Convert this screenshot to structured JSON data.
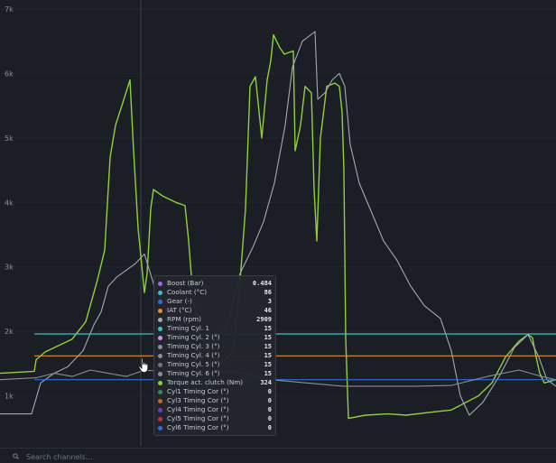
{
  "y_axis": {
    "ticks": [
      "7k",
      "6k",
      "5k",
      "4k",
      "3k",
      "2k",
      "1k"
    ]
  },
  "tooltip": {
    "rows": [
      {
        "name": "Boost (Bar)",
        "value": "0.484",
        "color": "#9b6bdc"
      },
      {
        "name": "Coolant (°C)",
        "value": "86",
        "color": "#3ec0c8"
      },
      {
        "name": "Gear (-)",
        "value": "3",
        "color": "#2f6fd6"
      },
      {
        "name": "IAT (°C)",
        "value": "46",
        "color": "#e0902a"
      },
      {
        "name": "RPM (rpm)",
        "value": "2909",
        "color": "#a4a8b0"
      },
      {
        "name": "Timing Cyl. 1",
        "value": "15",
        "color": "#3ec0c8"
      },
      {
        "name": "Timing Cyl. 2 (°)",
        "value": "15",
        "color": "#b99be6"
      },
      {
        "name": "Timing Cyl. 3 (°)",
        "value": "15",
        "color": "#8a8f99"
      },
      {
        "name": "Timing Cyl. 4 (°)",
        "value": "15",
        "color": "#8a8f99"
      },
      {
        "name": "Timing Cyl. 5 (°)",
        "value": "15",
        "color": "#6f747d"
      },
      {
        "name": "Timing Cyl. 6 (°)",
        "value": "15",
        "color": "#8a8f99"
      },
      {
        "name": "Torque act. clutch (Nm)",
        "value": "324",
        "color": "#8fd13a"
      },
      {
        "name": "Cyl1 Timing Cor (°)",
        "value": "0",
        "color": "#2e8f5a"
      },
      {
        "name": "Cyl3 Timing Cor (°)",
        "value": "0",
        "color": "#c06a2a"
      },
      {
        "name": "Cyl4 Timing Cor (°)",
        "value": "0",
        "color": "#6a3fc0"
      },
      {
        "name": "Cyl5 Timing Cor (°)",
        "value": "0",
        "color": "#c0304a"
      },
      {
        "name": "Cyl6 Timing Cor (°)",
        "value": "0",
        "color": "#2f6fd6"
      }
    ]
  },
  "search": {
    "placeholder": "Search channels..."
  },
  "chart_data": {
    "type": "line",
    "y_range": [
      0,
      7000
    ],
    "ticks": [
      7000,
      6000,
      5000,
      4000,
      3000,
      2000,
      1000
    ],
    "colors": {
      "torque": "#8fd13a",
      "rpm": "#a4a8b0",
      "coolant": "#3ec0c8",
      "iat": "#e0902a",
      "gear": "#2f6fd6",
      "timing": "#8a8f99"
    },
    "series": [
      {
        "key": "torque",
        "values": [
          [
            0,
            1350
          ],
          [
            38,
            1380
          ],
          [
            40,
            1560
          ],
          [
            50,
            1680
          ],
          [
            62,
            1760
          ],
          [
            80,
            1880
          ],
          [
            95,
            2150
          ],
          [
            108,
            2800
          ],
          [
            116,
            3260
          ],
          [
            122,
            4700
          ],
          [
            128,
            5200
          ],
          [
            135,
            5500
          ],
          [
            144,
            5900
          ],
          [
            148,
            4800
          ],
          [
            153,
            3600
          ],
          [
            160,
            2600
          ],
          [
            163,
            2900
          ],
          [
            167,
            3900
          ],
          [
            170,
            4200
          ],
          [
            180,
            4100
          ],
          [
            195,
            4000
          ],
          [
            205,
            3950
          ],
          [
            209,
            3400
          ],
          [
            214,
            2500
          ],
          [
            222,
            1900
          ],
          [
            232,
            1650
          ],
          [
            247,
            1500
          ],
          [
            258,
            1700
          ],
          [
            265,
            2600
          ],
          [
            272,
            3900
          ],
          [
            277,
            5800
          ],
          [
            283,
            5950
          ],
          [
            290,
            5000
          ],
          [
            296,
            5900
          ],
          [
            300,
            6200
          ],
          [
            303,
            6600
          ],
          [
            310,
            6400
          ],
          [
            315,
            6300
          ],
          [
            325,
            6350
          ],
          [
            327,
            4800
          ],
          [
            333,
            5200
          ],
          [
            338,
            5800
          ],
          [
            345,
            5700
          ],
          [
            348,
            4200
          ],
          [
            351,
            3400
          ],
          [
            355,
            5000
          ],
          [
            362,
            5800
          ],
          [
            371,
            5850
          ],
          [
            376,
            5800
          ],
          [
            379,
            5400
          ],
          [
            381,
            4500
          ],
          [
            383,
            1900
          ],
          [
            386,
            650
          ],
          [
            405,
            700
          ],
          [
            430,
            720
          ],
          [
            450,
            700
          ],
          [
            480,
            750
          ],
          [
            500,
            780
          ],
          [
            530,
            1000
          ],
          [
            545,
            1200
          ],
          [
            560,
            1600
          ],
          [
            575,
            1850
          ],
          [
            585,
            1950
          ],
          [
            590,
            1900
          ],
          [
            594,
            1600
          ],
          [
            598,
            1350
          ],
          [
            603,
            1200
          ],
          [
            616,
            1250
          ]
        ]
      },
      {
        "key": "rpm",
        "values": [
          [
            0,
            720
          ],
          [
            35,
            720
          ],
          [
            45,
            1200
          ],
          [
            60,
            1350
          ],
          [
            75,
            1450
          ],
          [
            92,
            1700
          ],
          [
            104,
            2100
          ],
          [
            112,
            2300
          ],
          [
            120,
            2700
          ],
          [
            130,
            2850
          ],
          [
            140,
            2950
          ],
          [
            150,
            3050
          ],
          [
            160,
            3200
          ],
          [
            172,
            2650
          ],
          [
            186,
            2300
          ],
          [
            205,
            1900
          ],
          [
            222,
            1650
          ],
          [
            240,
            1900
          ],
          [
            252,
            2100
          ],
          [
            266,
            2900
          ],
          [
            280,
            3300
          ],
          [
            292,
            3700
          ],
          [
            304,
            4300
          ],
          [
            316,
            5200
          ],
          [
            324,
            6100
          ],
          [
            335,
            6500
          ],
          [
            349,
            6650
          ],
          [
            352,
            5600
          ],
          [
            360,
            5700
          ],
          [
            368,
            5900
          ],
          [
            376,
            6000
          ],
          [
            382,
            5800
          ],
          [
            388,
            4900
          ],
          [
            398,
            4300
          ],
          [
            410,
            3900
          ],
          [
            425,
            3400
          ],
          [
            440,
            3100
          ],
          [
            455,
            2700
          ],
          [
            470,
            2400
          ],
          [
            488,
            2200
          ],
          [
            500,
            1700
          ],
          [
            510,
            1000
          ],
          [
            520,
            700
          ],
          [
            535,
            900
          ],
          [
            553,
            1300
          ],
          [
            570,
            1750
          ],
          [
            585,
            1950
          ],
          [
            597,
            1600
          ],
          [
            606,
            1250
          ],
          [
            616,
            1150
          ]
        ]
      },
      {
        "key": "coolant",
        "values": [
          [
            38,
            1960
          ],
          [
            616,
            1960
          ]
        ]
      },
      {
        "key": "iat",
        "values": [
          [
            38,
            1620
          ],
          [
            616,
            1620
          ]
        ]
      },
      {
        "key": "gear",
        "values": [
          [
            38,
            1250
          ],
          [
            616,
            1250
          ]
        ]
      },
      {
        "key": "timing",
        "values": [
          [
            0,
            1250
          ],
          [
            40,
            1280
          ],
          [
            60,
            1350
          ],
          [
            80,
            1300
          ],
          [
            100,
            1400
          ],
          [
            120,
            1350
          ],
          [
            140,
            1300
          ],
          [
            160,
            1400
          ],
          [
            200,
            1350
          ],
          [
            260,
            1380
          ],
          [
            300,
            1250
          ],
          [
            340,
            1200
          ],
          [
            380,
            1150
          ],
          [
            420,
            1150
          ],
          [
            460,
            1150
          ],
          [
            500,
            1160
          ],
          [
            540,
            1300
          ],
          [
            575,
            1400
          ],
          [
            600,
            1300
          ],
          [
            616,
            1250
          ]
        ]
      }
    ]
  }
}
